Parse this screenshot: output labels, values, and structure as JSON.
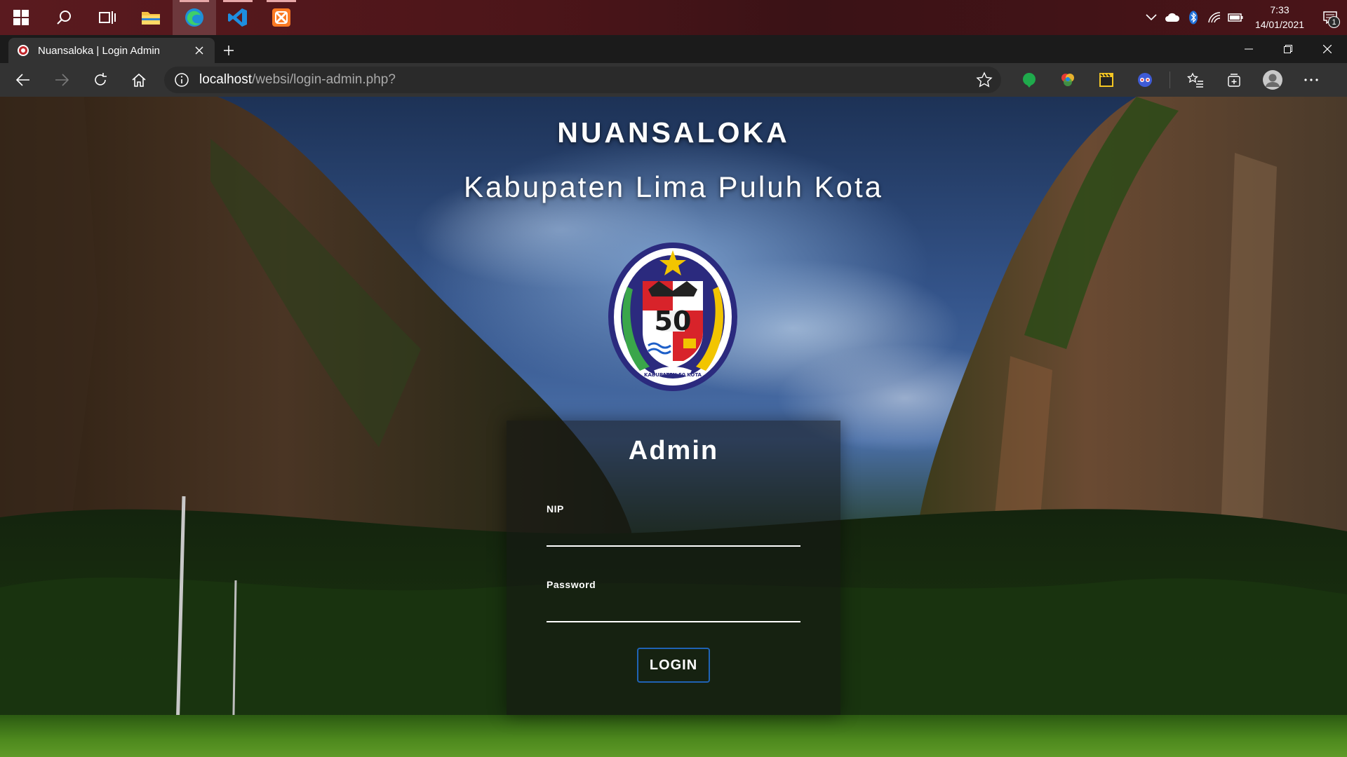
{
  "taskbar": {
    "apps": [
      {
        "name": "start",
        "icon": "windows-icon"
      },
      {
        "name": "search",
        "icon": "search-icon"
      },
      {
        "name": "task-view",
        "icon": "task-view-icon"
      },
      {
        "name": "file-explorer",
        "icon": "folder-icon"
      },
      {
        "name": "edge",
        "icon": "edge-icon"
      },
      {
        "name": "vscode",
        "icon": "vscode-icon"
      },
      {
        "name": "xampp",
        "icon": "xampp-icon"
      }
    ],
    "clock": {
      "time": "7:33",
      "date": "14/01/2021"
    },
    "notification_count": "1",
    "accent_color": "#5a1a1f"
  },
  "browser": {
    "tab": {
      "title": "Nuansaloka | Login Admin"
    },
    "url": {
      "host": "localhost",
      "path": "/websi/login-admin.php?"
    }
  },
  "page": {
    "title": "NUANSALOKA",
    "subtitle": "Kabupaten Lima Puluh Kota",
    "logo": {
      "number": "50",
      "ring_text": "KABUPATEN 50 KOTA"
    },
    "login": {
      "heading": "Admin",
      "nip_label": "NIP",
      "nip_value": "",
      "password_label": "Password",
      "password_value": "",
      "button_label": "LOGIN",
      "button_border_color": "#1f63b5"
    }
  }
}
